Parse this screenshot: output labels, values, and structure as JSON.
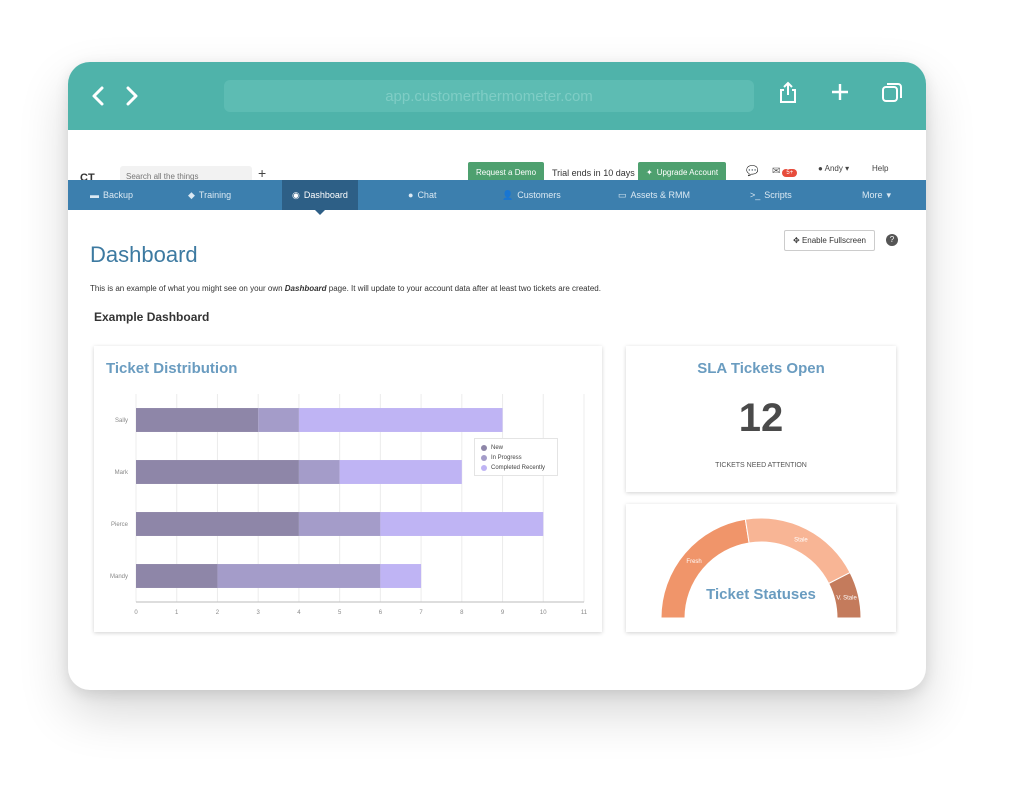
{
  "browser": {
    "url": "app.customerthermometer.com"
  },
  "header": {
    "logo": "CT",
    "search_placeholder": "Search all the things",
    "plus_label": "+",
    "request_demo": "Request a Demo",
    "trial_text": "Trial ends in 10 days",
    "upgrade_label": "Upgrade Account",
    "notifications_badge": "5+",
    "user_name": "Andy",
    "help_label": "Help"
  },
  "tabs": [
    {
      "label": "Backup",
      "icon": "drive-icon"
    },
    {
      "label": "Training",
      "icon": "graduation-cap-icon"
    },
    {
      "label": "Dashboard",
      "icon": "gauge-icon",
      "active": true
    },
    {
      "label": "Chat",
      "icon": "chat-bubble-icon"
    },
    {
      "label": "Customers",
      "icon": "person-icon"
    },
    {
      "label": "Assets & RMM",
      "icon": "monitor-icon"
    },
    {
      "label": "Scripts",
      "icon": "terminal-icon"
    },
    {
      "label": "More",
      "icon": "caret-down-icon"
    }
  ],
  "page": {
    "title": "Dashboard",
    "fullscreen_label": "Enable Fullscreen",
    "intro_before": "This is an example of what you might see on your own ",
    "intro_em": "Dashboard",
    "intro_after": " page. It will update to your account data after at least two tickets are created.",
    "section_title": "Example Dashboard"
  },
  "sla": {
    "title": "SLA Tickets Open",
    "count": "12",
    "subtitle": "TICKETS NEED ATTENTION"
  },
  "chart_data": [
    {
      "type": "bar",
      "orientation": "horizontal",
      "stacked": true,
      "title": "Ticket Distribution",
      "categories": [
        "Sally",
        "Mark",
        "Pierce",
        "Mandy"
      ],
      "series": [
        {
          "name": "New",
          "values": [
            3,
            4,
            4,
            2
          ],
          "color": "#8e86a8"
        },
        {
          "name": "In Progress",
          "values": [
            1,
            1,
            2,
            4
          ],
          "color": "#a49cc9"
        },
        {
          "name": "Completed Recently",
          "values": [
            5,
            3,
            4,
            1
          ],
          "color": "#bfb4f4"
        }
      ],
      "xlim": [
        0,
        11
      ],
      "xticks": [
        "0",
        "1",
        "2",
        "3",
        "4",
        "5",
        "6",
        "7",
        "8",
        "9",
        "10",
        "11"
      ],
      "grid": true,
      "legend": "top-right"
    },
    {
      "type": "pie",
      "shape": "semi-donut",
      "title": "Ticket Statuses",
      "categories": [
        "Fresh",
        "Stale",
        "V. Stale"
      ],
      "values": [
        45,
        40,
        15
      ],
      "colors": [
        "#f0956a",
        "#f8b595",
        "#c47b5c"
      ]
    }
  ]
}
